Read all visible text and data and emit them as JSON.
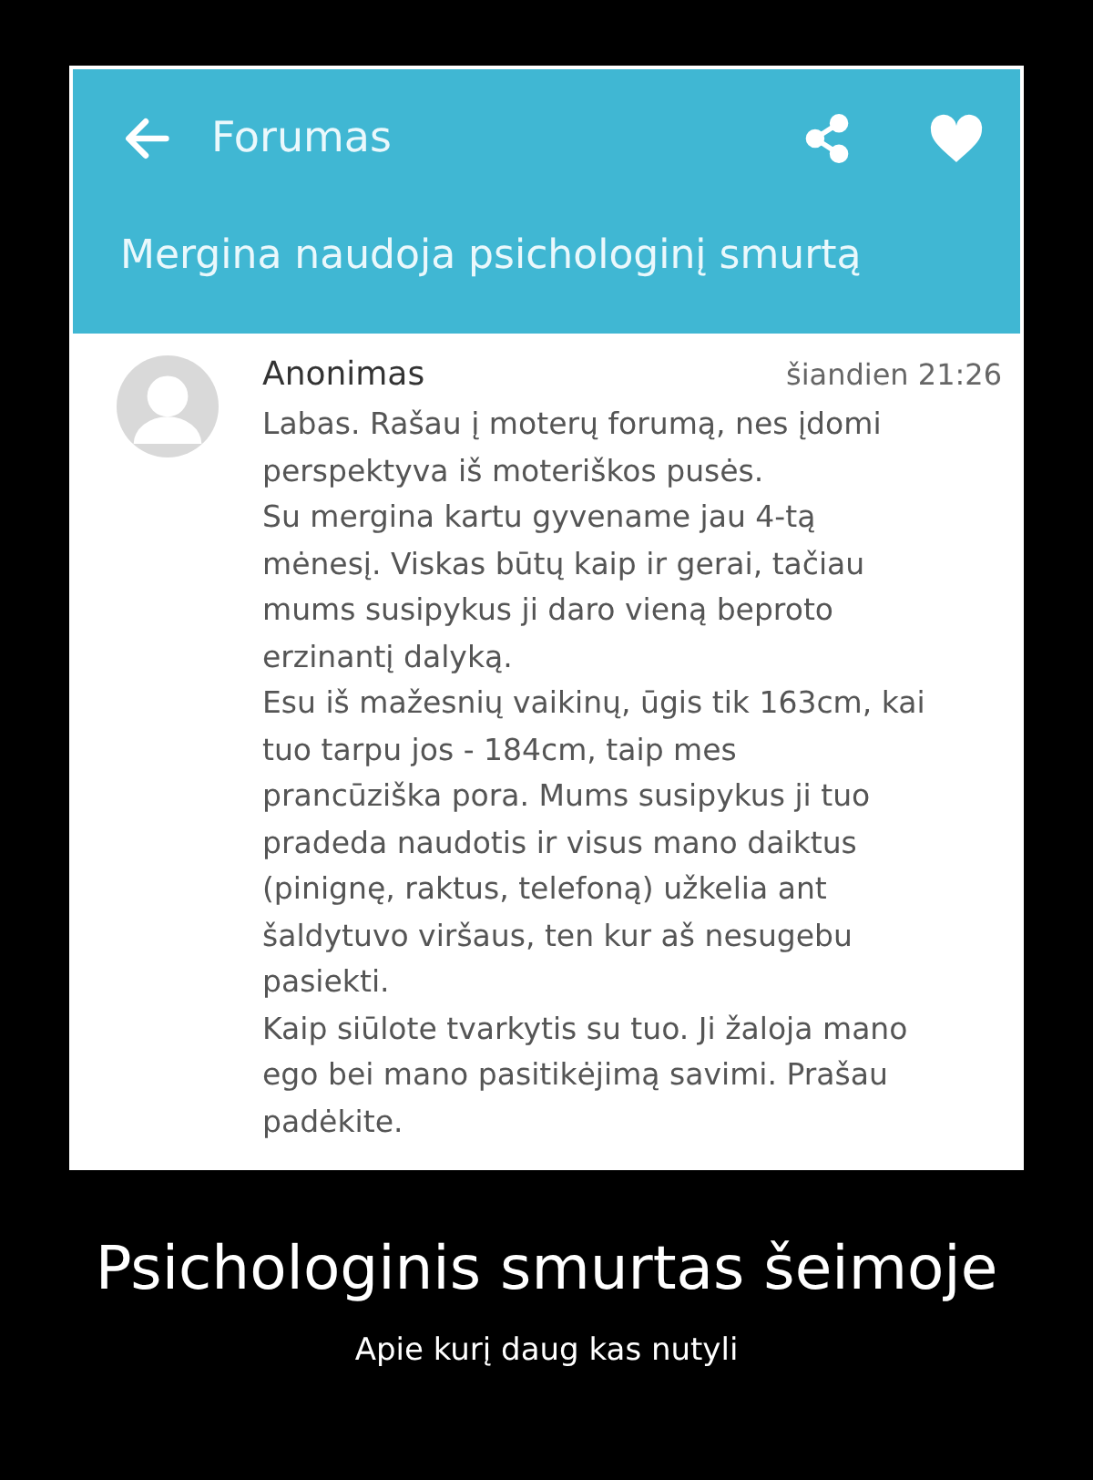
{
  "app_bar": {
    "title": "Forumas",
    "subtitle": "Mergina naudoja psichologinį smurtą"
  },
  "post": {
    "author": "Anonimas",
    "time": "šiandien 21:26",
    "lines": [
      "Labas. Rašau į moterų forumą, nes įdomi",
      "perspektyva iš moteriškos pusės.",
      "Su mergina kartu gyvename jau 4-tą",
      "mėnesį. Viskas būtų kaip ir gerai, tačiau",
      "mums susipykus ji daro vieną beproto",
      "erzinantį dalyką.",
      "Esu iš mažesnių vaikinų, ūgis tik 163cm, kai",
      "tuo tarpu jos - 184cm, taip mes",
      "prancūziška pora. Mums susipykus ji tuo",
      "pradeda naudotis ir visus mano daiktus",
      "(pinignę, raktus, telefoną) užkelia ant",
      "šaldytuvo viršaus, ten kur aš nesugebu",
      "pasiekti.",
      "Kaip siūlote tvarkytis su tuo. Ji žaloja mano",
      "ego bei mano pasitikėjimą savimi. Prašau",
      "padėkite."
    ]
  },
  "caption": {
    "title": "Psichologinis smurtas šeimoje",
    "subtitle": "Apie kurį daug kas nutyli"
  }
}
